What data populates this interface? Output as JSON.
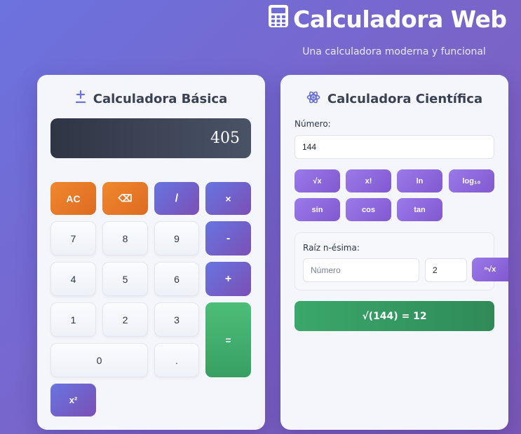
{
  "header": {
    "icon": "calculator-icon",
    "title": "Calculadora Web",
    "subtitle": "Una calculadora moderna y funcional"
  },
  "basic": {
    "title": "Calculadora Básica",
    "title_icon": "plus-minus-icon",
    "display": "405",
    "keys": {
      "ac": "AC",
      "backspace": "⌫",
      "divide": "/",
      "multiply": "×",
      "seven": "7",
      "eight": "8",
      "nine": "9",
      "minus": "-",
      "four": "4",
      "five": "5",
      "six": "6",
      "plus": "+",
      "one": "1",
      "two": "2",
      "three": "3",
      "equals": "=",
      "zero": "0",
      "dot": ".",
      "square": "x²"
    }
  },
  "scientific": {
    "title": "Calculadora Científica",
    "title_icon": "atom-icon",
    "number_label": "Número:",
    "number_value": "144",
    "functions": [
      "√x",
      "x!",
      "ln",
      "log₁₀",
      "sin",
      "cos",
      "tan"
    ],
    "nroot": {
      "label": "Raíz n-ésima:",
      "number_placeholder": "Número",
      "n_value": "2",
      "button": "ⁿ√x"
    },
    "result": "√(144) = 12"
  },
  "colors": {
    "background": "#6c72df",
    "operator": "#6875e0",
    "clear": "#dd6b20",
    "equals": "#37a062",
    "function": "#8258d0",
    "result": "#2f8a58"
  }
}
